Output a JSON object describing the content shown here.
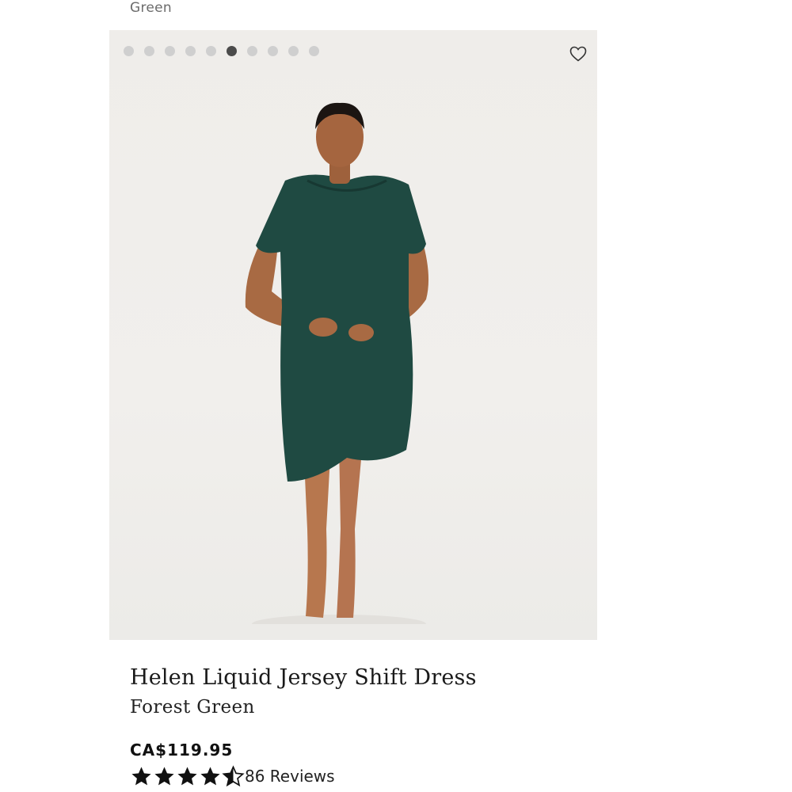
{
  "swatch": {
    "label": "Green"
  },
  "gallery": {
    "dot_count": 10,
    "active_index": 5,
    "favorite_icon": "heart-outline-icon"
  },
  "product": {
    "name": "Helen Liquid Jersey Shift Dress",
    "color": "Forest Green",
    "price": "CA$119.95",
    "rating": 4.5,
    "rating_max": 5,
    "reviews": "86 Reviews"
  },
  "colors": {
    "dress": "#1f4a42",
    "dot_active": "#4b4b4b",
    "dot_inactive": "#cfcfcf",
    "star": "#111111"
  }
}
